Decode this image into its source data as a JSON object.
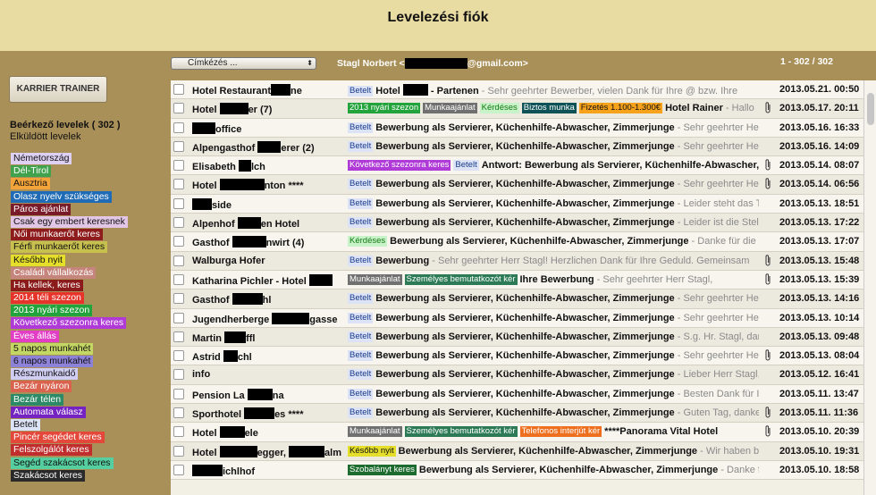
{
  "app": {
    "title": "Levelezési fiók"
  },
  "sidebar": {
    "trainer_button": "KARRIER TRAINER",
    "inbox_label": "Beérkező levelek ( 302 )",
    "sent_label": "Elküldött levelek",
    "labels": [
      {
        "text": "Németország",
        "bg": "#ddd0f3",
        "fg": "#111"
      },
      {
        "text": "Dél-Tirol",
        "bg": "#41a24e",
        "fg": "#fff"
      },
      {
        "text": "Ausztria",
        "bg": "#f2a43a",
        "fg": "#111"
      },
      {
        "text": "Olasz nyelv szükséges",
        "bg": "#1f6bb5",
        "fg": "#fff"
      },
      {
        "text": "Páros ajánlat",
        "bg": "#7a1b2a",
        "fg": "#fff"
      },
      {
        "text": "Csak egy embert keresnek",
        "bg": "#e1c6e6",
        "fg": "#111"
      },
      {
        "text": "Női munkaerőt keres",
        "bg": "#8e1c1c",
        "fg": "#fff"
      },
      {
        "text": "Férfi munkaerőt keres",
        "bg": "#c7c04e",
        "fg": "#111"
      },
      {
        "text": "Később nyit",
        "bg": "#e5df2b",
        "fg": "#111"
      },
      {
        "text": "Családi vállalkozás",
        "bg": "#c5847c",
        "fg": "#fff"
      },
      {
        "text": "Ha kellek, keres",
        "bg": "#8b1a1a",
        "fg": "#fff"
      },
      {
        "text": "2014 téli szezon",
        "bg": "#e6342b",
        "fg": "#fff"
      },
      {
        "text": "2013 nyári szezon",
        "bg": "#23a33b",
        "fg": "#fff"
      },
      {
        "text": "Következő szezonra keres",
        "bg": "#b03ad8",
        "fg": "#fff"
      },
      {
        "text": "Éves állás",
        "bg": "#e33fc6",
        "fg": "#fff"
      },
      {
        "text": "5 napos munkahét",
        "bg": "#c4d663",
        "fg": "#111"
      },
      {
        "text": "6 napos munkahét",
        "bg": "#8c82d8",
        "fg": "#111"
      },
      {
        "text": "Részmunkaidő",
        "bg": "#cfcdf2",
        "fg": "#111"
      },
      {
        "text": "Bezár nyáron",
        "bg": "#d9634f",
        "fg": "#fff"
      },
      {
        "text": "Bezár télen",
        "bg": "#2c8a66",
        "fg": "#fff"
      },
      {
        "text": "Automata válasz",
        "bg": "#7524c2",
        "fg": "#fff"
      },
      {
        "text": "Betelt",
        "bg": "#dde3f6",
        "fg": "#111"
      },
      {
        "text": "Pincér segédet keres",
        "bg": "#e4483a",
        "fg": "#fff"
      },
      {
        "text": "Felszolgálót keres",
        "bg": "#c12d2d",
        "fg": "#fff"
      },
      {
        "text": "Segéd szakácsot keres",
        "bg": "#55cfa0",
        "fg": "#111"
      },
      {
        "text": "Szakácsot keres",
        "bg": "#2a2a2a",
        "fg": "#fff"
      }
    ]
  },
  "toolbar": {
    "select_value": "Címkézés ...",
    "account_name": "Stagl Norbert",
    "account_open": "<",
    "account_domain": "@gmail.com>",
    "counter": "1 - 302 / 302"
  },
  "colors": {
    "Betelt": [
      "#dde3f6",
      "#1a3c8c"
    ],
    "2013 nyári szezon": [
      "#23a33b",
      "#fff"
    ],
    "Munkaajánlat": [
      "#707070",
      "#fff"
    ],
    "Kérdéses": [
      "#c8f2c8",
      "#157a15"
    ],
    "Biztos munka": [
      "#0d5257",
      "#fff"
    ],
    "Fizetés 1.100-1.300€": [
      "#f7a21b",
      "#111"
    ],
    "Következő szezonra keres": [
      "#b03ad8",
      "#fff"
    ],
    "Személyes bemutatkozót kér": [
      "#2c7a56",
      "#fff"
    ],
    "Telefonos interjút kér": [
      "#ee6f1e",
      "#fff"
    ],
    "Később nyit": [
      "#e5df2b",
      "#111"
    ],
    "Szobalányt keres": [
      "#1d6b2e",
      "#fff"
    ]
  },
  "emails": [
    {
      "sender_pre": "Hotel Restaurant",
      "redact": 22,
      "sender_post": "ne",
      "tags": [
        "Betelt"
      ],
      "subject_pre": "Hotel ",
      "subject_redact": 28,
      "subject": " - Partenen",
      "snippet": " - Sehr geehrter Bewerber, vielen Dank für Ihre @ bzw. Ihre",
      "attach": false,
      "date": "2013.05.21. 00:50"
    },
    {
      "sender_pre": "Hotel ",
      "redact": 32,
      "sender_post": "er (7)",
      "tags": [
        "2013 nyári szezon",
        "Munkaajánlat",
        "Kérdéses",
        "Biztos munka",
        "Fizetés 1.100-1.300€"
      ],
      "subject": "Hotel Rainer",
      "snippet": " - Hallo",
      "attach": true,
      "date": "2013.05.17. 20:11"
    },
    {
      "sender_pre": "",
      "redact": 26,
      "sender_post": "office",
      "tags": [
        "Betelt"
      ],
      "subject": "Bewerbung als Servierer, Küchenhilfe-Abwascher, Zimmerjunge",
      "snippet": " - Sehr geehrter Herr",
      "attach": false,
      "date": "2013.05.16. 16:33"
    },
    {
      "sender_pre": "Alpengasthof ",
      "redact": 26,
      "sender_post": "erer (2)",
      "tags": [
        "Betelt"
      ],
      "subject": "Bewerbung als Servierer, Küchenhilfe-Abwascher, Zimmerjunge",
      "snippet": " - Sehr geehrter Herr",
      "attach": false,
      "date": "2013.05.16. 14:09"
    },
    {
      "sender_pre": "Elisabeth ",
      "redact": 14,
      "sender_post": "lch",
      "tags": [
        "Következő szezonra keres",
        "Betelt"
      ],
      "subject": "Antwort: Bewerbung als Servierer, Küchenhilfe-Abwascher,",
      "snippet": "",
      "attach": true,
      "date": "2013.05.14. 08:07"
    },
    {
      "sender_pre": "Hotel ",
      "redact": 50,
      "sender_post": "nton ****",
      "tags": [
        "Betelt"
      ],
      "subject": "Bewerbung als Servierer, Küchenhilfe-Abwascher, Zimmerjunge",
      "snippet": " - Sehr geehrter Herr",
      "attach": true,
      "date": "2013.05.14. 06:56"
    },
    {
      "sender_pre": "",
      "redact": 22,
      "sender_post": "side",
      "tags": [
        "Betelt"
      ],
      "subject": "Bewerbung als Servierer, Küchenhilfe-Abwascher, Zimmerjunge",
      "snippet": " - Leider steht das Team",
      "attach": false,
      "date": "2013.05.13. 18:51"
    },
    {
      "sender_pre": "Alpenhof ",
      "redact": 26,
      "sender_post": "en Hotel",
      "tags": [
        "Betelt"
      ],
      "subject": "Bewerbung als Servierer, Küchenhilfe-Abwascher, Zimmerjunge",
      "snippet": " - Leider ist die Stelle",
      "attach": false,
      "date": "2013.05.13. 17:22"
    },
    {
      "sender_pre": "Gasthof ",
      "redact": 38,
      "sender_post": "nwirt (4)",
      "tags": [
        "Kérdéses"
      ],
      "subject": "Bewerbung als Servierer, Küchenhilfe-Abwascher, Zimmerjunge",
      "snippet": " - Danke für die Info!",
      "attach": false,
      "date": "2013.05.13. 17:07"
    },
    {
      "sender_pre": "Walburga Hofer",
      "redact": 0,
      "sender_post": "",
      "tags": [
        "Betelt"
      ],
      "subject": "Bewerbung",
      "snippet": " - Sehr geehrter Herr Stagl! Herzlichen Dank für Ihre Geduld. Gemeinsam",
      "attach": true,
      "date": "2013.05.13. 15:48"
    },
    {
      "sender_pre": "Katharina Pichler - Hotel ",
      "redact": 26,
      "sender_post": "",
      "tags": [
        "Munkaajánlat",
        "Személyes bemutatkozót kér"
      ],
      "subject": "Ihre Bewerbung",
      "snippet": " - Sehr geehrter Herr Stagl,",
      "attach": true,
      "date": "2013.05.13. 15:39"
    },
    {
      "sender_pre": "Gasthof ",
      "redact": 34,
      "sender_post": "hl",
      "tags": [
        "Betelt"
      ],
      "subject": "Bewerbung als Servierer, Küchenhilfe-Abwascher, Zimmerjunge",
      "snippet": " - Sehr geehrter Herr",
      "attach": false,
      "date": "2013.05.13. 14:16"
    },
    {
      "sender_pre": "Jugendherberge ",
      "redact": 42,
      "sender_post": "gasse",
      "tags": [
        "Betelt"
      ],
      "subject": "Bewerbung als Servierer, Küchenhilfe-Abwascher, Zimmerjunge",
      "snippet": " - Sehr geehrter Herr",
      "attach": false,
      "date": "2013.05.13. 10:14"
    },
    {
      "sender_pre": "Martin ",
      "redact": 24,
      "sender_post": "ffl",
      "tags": [
        "Betelt"
      ],
      "subject": "Bewerbung als Servierer, Küchenhilfe-Abwascher, Zimmerjunge",
      "snippet": " - S.g. Hr. Stagl, danke",
      "attach": false,
      "date": "2013.05.13. 09:48"
    },
    {
      "sender_pre": "Astrid ",
      "redact": 16,
      "sender_post": "chl",
      "tags": [
        "Betelt"
      ],
      "subject": "Bewerbung als Servierer, Küchenhilfe-Abwascher, Zimmerjunge",
      "snippet": " - Sehr geehrter Herr",
      "attach": true,
      "date": "2013.05.13. 08:04"
    },
    {
      "sender_pre": "info",
      "redact": 0,
      "sender_post": "",
      "tags": [
        "Betelt"
      ],
      "subject": "Bewerbung als Servierer, Küchenhilfe-Abwascher, Zimmerjunge",
      "snippet": " - Lieber Herr Stagl,",
      "attach": false,
      "date": "2013.05.12. 16:41"
    },
    {
      "sender_pre": "Pension La ",
      "redact": 28,
      "sender_post": "na",
      "tags": [
        "Betelt"
      ],
      "subject": "Bewerbung als Servierer, Küchenhilfe-Abwascher, Zimmerjunge",
      "snippet": " - Besten Dank für Ihre",
      "attach": false,
      "date": "2013.05.11. 13:47"
    },
    {
      "sender_pre": "Sporthotel ",
      "redact": 34,
      "sender_post": "es ****",
      "tags": [
        "Betelt"
      ],
      "subject": "Bewerbung als Servierer, Küchenhilfe-Abwascher, Zimmerjunge",
      "snippet": " - Guten Tag, danke",
      "attach": true,
      "date": "2013.05.11. 11:36"
    },
    {
      "sender_pre": "Hotel ",
      "redact": 28,
      "sender_post": "ele",
      "tags": [
        "Munkaajánlat",
        "Személyes bemutatkozót kér",
        "Telefonos interjút kér"
      ],
      "subject": "****Panorama Vital Hotel",
      "snippet": "",
      "attach": true,
      "date": "2013.05.10. 20:39"
    },
    {
      "sender_pre": "Hotel ",
      "redact": 42,
      "sender_post": "egger, ",
      "redact2": 40,
      "sender_post2": "alm",
      "tags": [
        "Később nyit"
      ],
      "subject": "Bewerbung als Servierer, Küchenhilfe-Abwascher, Zimmerjunge",
      "snippet": " - Wir haben bis",
      "attach": false,
      "date": "2013.05.10. 19:31"
    },
    {
      "sender_pre": "",
      "redact": 34,
      "sender_post": "ichlhof",
      "tags": [
        "Szobalányt keres"
      ],
      "subject": "Bewerbung als Servierer, Küchenhilfe-Abwascher, Zimmerjunge",
      "snippet": " - Danke für",
      "attach": false,
      "date": "2013.05.10. 18:58"
    }
  ]
}
